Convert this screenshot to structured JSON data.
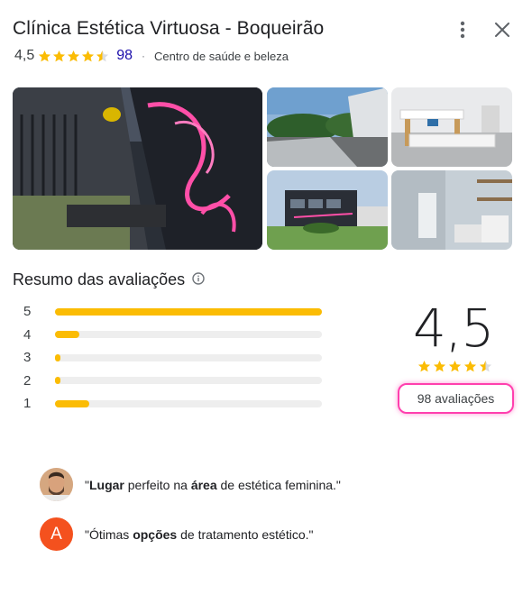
{
  "header": {
    "title": "Clínica Estética Virtuosa - Boqueirão",
    "rating": "4,5",
    "review_count": "98",
    "separator": "·",
    "category": "Centro de saúde e beleza"
  },
  "rating_value": 4.5,
  "summary": {
    "title": "Resumo das avaliações",
    "average": "4,5",
    "reviews_label": "98 avaliações",
    "distribution": [
      {
        "label": "5",
        "fraction": 1.0
      },
      {
        "label": "4",
        "fraction": 0.09
      },
      {
        "label": "3",
        "fraction": 0.015
      },
      {
        "label": "2",
        "fraction": 0.015
      },
      {
        "label": "1",
        "fraction": 0.13
      }
    ]
  },
  "snippets": [
    {
      "quote_open": "\"",
      "b1": "Lugar",
      "t1": " perfeito na ",
      "b2": "área",
      "t2": " de estética feminina.\""
    },
    {
      "quote_open": "\"Ótimas ",
      "b1": "opções",
      "t1": " de tratamento estético.\"",
      "b2": "",
      "t2": "",
      "avatar_letter": "A"
    }
  ],
  "colors": {
    "star": "#fbbc04",
    "link": "#1a0dab",
    "highlight": "#ff3fae",
    "avatar_orange": "#f4511e"
  },
  "icons": {
    "more": "more-vert-icon",
    "close": "close-icon",
    "info": "info-icon"
  }
}
